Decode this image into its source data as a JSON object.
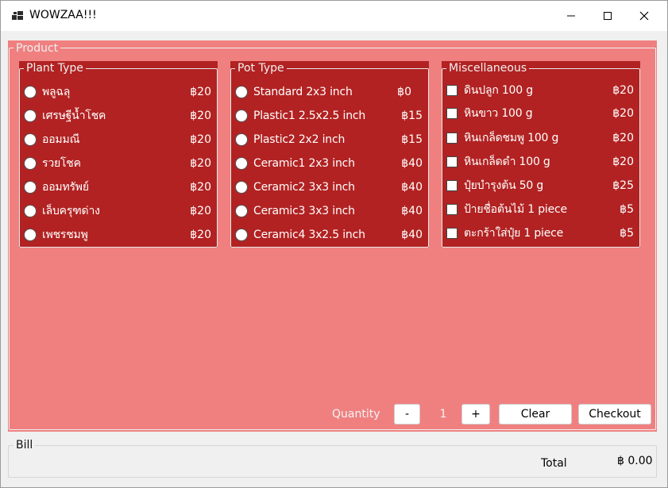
{
  "window": {
    "title": "WOWZAA!!!",
    "icon": "app-window-icon",
    "controls": [
      "minimize-icon",
      "maximize-icon",
      "close-icon"
    ]
  },
  "product": {
    "legend": "Product",
    "plant_type": {
      "legend": "Plant Type",
      "items": [
        {
          "label": "พลูฉลุ",
          "price": "฿20"
        },
        {
          "label": "เศรษฐีน้ำโชค",
          "price": "฿20"
        },
        {
          "label": "ออมมณี",
          "price": "฿20"
        },
        {
          "label": "รวยโชค",
          "price": "฿20"
        },
        {
          "label": "ออมทรัพย์",
          "price": "฿20"
        },
        {
          "label": "เล็บครุฑด่าง",
          "price": "฿20"
        },
        {
          "label": "เพชรชมพู",
          "price": "฿20"
        }
      ]
    },
    "pot_type": {
      "legend": "Pot Type",
      "items": [
        {
          "label": "Standard 2x3 inch",
          "price": "฿0"
        },
        {
          "label": "Plastic1 2.5x2.5 inch",
          "price": "฿15"
        },
        {
          "label": "Plastic2 2x2 inch",
          "price": "฿15"
        },
        {
          "label": "Ceramic1 2x3 inch",
          "price": "฿40"
        },
        {
          "label": "Ceramic2 3x3 inch",
          "price": "฿40"
        },
        {
          "label": "Ceramic3 3x3 inch",
          "price": "฿40"
        },
        {
          "label": "Ceramic4 3x2.5 inch",
          "price": "฿40"
        }
      ]
    },
    "misc": {
      "legend": "Miscellaneous",
      "items": [
        {
          "label": "ดินปลูก 100 g",
          "price": "฿20"
        },
        {
          "label": "หินขาว 100 g",
          "price": "฿20"
        },
        {
          "label": "หินเกล็ดชมพู 100 g",
          "price": "฿20"
        },
        {
          "label": "หินเกล็ดดำ 100 g",
          "price": "฿20"
        },
        {
          "label": "ปุ๋ยบำรุงต้น 50 g",
          "price": "฿25"
        },
        {
          "label": "ป้ายชื่อต้นไม้ 1 piece",
          "price": "฿5"
        },
        {
          "label": "ตะกร้าใส่ปุ๋ย 1 piece",
          "price": "฿5"
        }
      ]
    },
    "quantity": {
      "label": "Quantity",
      "minus_label": "-",
      "value": "1",
      "plus_label": "+"
    },
    "clear_label": "Clear",
    "checkout_label": "Checkout"
  },
  "bill": {
    "legend": "Bill",
    "total_label": "Total",
    "total_value": "฿ 0.00"
  },
  "colors": {
    "product_bg": "#f08080",
    "group_bg": "#b22222",
    "window_bg": "#f0f0f0"
  }
}
